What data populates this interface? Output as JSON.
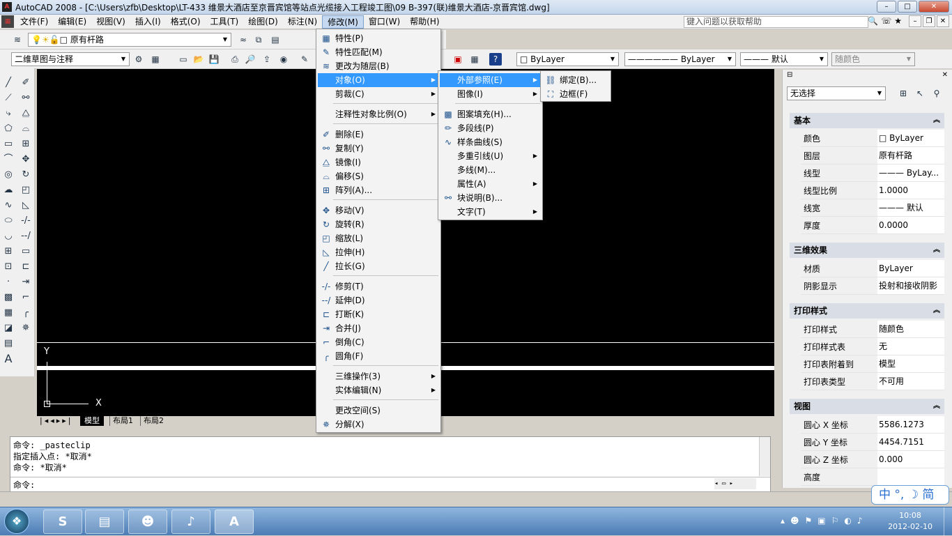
{
  "window": {
    "title": "AutoCAD 2008 - [C:\\Users\\zfb\\Desktop\\LT-433 维景大酒店至京晋宾馆等站点光缆接入工程竣工图\\09 B-397(联)维景大酒店-京晋宾馆.dwg]",
    "min": "–",
    "max": "□",
    "close": "✕",
    "app_icon": "A"
  },
  "menubar": {
    "items": [
      "文件(F)",
      "编辑(E)",
      "视图(V)",
      "插入(I)",
      "格式(O)",
      "工具(T)",
      "绘图(D)",
      "标注(N)",
      "修改(M)",
      "窗口(W)",
      "帮助(H)"
    ],
    "help_placeholder": "键入问题以获取帮助"
  },
  "toolbar": {
    "layer": "原有杆路",
    "workspace": "二维草图与注释",
    "color": "ByLayer",
    "linetype": "ByLayer",
    "lineweight": "默认",
    "plotstyle": "随颜色"
  },
  "modify_menu": {
    "items": [
      {
        "label": "特性(P)",
        "icon": "properties-icon"
      },
      {
        "label": "特性匹配(M)",
        "icon": "match-icon"
      },
      {
        "label": "更改为随层(B)",
        "icon": "bylayer-icon"
      },
      {
        "label": "对象(O)",
        "sub": true
      },
      {
        "label": "剪裁(C)",
        "sub": true
      },
      {
        "label": "注释性对象比例(O)",
        "sub": true
      },
      {
        "label": "删除(E)",
        "icon": "erase-icon"
      },
      {
        "label": "复制(Y)",
        "icon": "copy-icon"
      },
      {
        "label": "镜像(I)",
        "icon": "mirror-icon"
      },
      {
        "label": "偏移(S)",
        "icon": "offset-icon"
      },
      {
        "label": "阵列(A)...",
        "icon": "array-icon"
      },
      {
        "label": "移动(V)",
        "icon": "move-icon"
      },
      {
        "label": "旋转(R)",
        "icon": "rotate-icon"
      },
      {
        "label": "缩放(L)",
        "icon": "scale-icon"
      },
      {
        "label": "拉伸(H)",
        "icon": "stretch-icon"
      },
      {
        "label": "拉长(G)",
        "icon": "lengthen-icon"
      },
      {
        "label": "修剪(T)",
        "icon": "trim-icon"
      },
      {
        "label": "延伸(D)",
        "icon": "extend-icon"
      },
      {
        "label": "打断(K)",
        "icon": "break-icon"
      },
      {
        "label": "合并(J)",
        "icon": "join-icon"
      },
      {
        "label": "倒角(C)",
        "icon": "chamfer-icon"
      },
      {
        "label": "圆角(F)",
        "icon": "fillet-icon"
      },
      {
        "label": "三维操作(3)",
        "sub": true
      },
      {
        "label": "实体编辑(N)",
        "sub": true
      },
      {
        "label": "更改空间(S)"
      },
      {
        "label": "分解(X)",
        "icon": "explode-icon"
      }
    ]
  },
  "object_menu": {
    "items": [
      {
        "label": "外部参照(E)",
        "sub": true
      },
      {
        "label": "图像(I)",
        "sub": true
      },
      {
        "label": "图案填充(H)...",
        "icon": "hatch-icon"
      },
      {
        "label": "多段线(P)",
        "icon": "polyline-icon"
      },
      {
        "label": "样条曲线(S)",
        "icon": "spline-icon"
      },
      {
        "label": "多重引线(U)",
        "sub": true
      },
      {
        "label": "多线(M)..."
      },
      {
        "label": "属性(A)",
        "sub": true
      },
      {
        "label": "块说明(B)...",
        "icon": "block-icon"
      },
      {
        "label": "文字(T)",
        "sub": true
      }
    ]
  },
  "xref_menu": {
    "items": [
      {
        "label": "绑定(B)...",
        "icon": "bind-icon"
      },
      {
        "label": "边框(F)",
        "icon": "frame-icon"
      }
    ]
  },
  "drawing": {
    "axis_y": "Y",
    "axis_x": "X"
  },
  "layout_tabs": [
    "模型",
    "布局1",
    "布局2"
  ],
  "command": {
    "lines": [
      "命令: _pasteclip",
      "指定插入点: *取消*",
      "命令: *取消*"
    ],
    "prompt": "命令:"
  },
  "properties": {
    "selection": "无选择",
    "sections": [
      {
        "title": "基本",
        "rows": [
          [
            "颜色",
            "□ ByLayer"
          ],
          [
            "图层",
            "原有杆路"
          ],
          [
            "线型",
            "——— ByLay..."
          ],
          [
            "线型比例",
            "1.0000"
          ],
          [
            "线宽",
            "——— 默认"
          ],
          [
            "厚度",
            "0.0000"
          ]
        ]
      },
      {
        "title": "三维效果",
        "rows": [
          [
            "材质",
            "ByLayer"
          ],
          [
            "阴影显示",
            "投射和接收阴影"
          ]
        ]
      },
      {
        "title": "打印样式",
        "rows": [
          [
            "打印样式",
            "随颜色"
          ],
          [
            "打印样式表",
            "无"
          ],
          [
            "打印表附着到",
            "模型"
          ],
          [
            "打印表类型",
            "不可用"
          ]
        ]
      },
      {
        "title": "视图",
        "rows": [
          [
            "圆心 X 坐标",
            "5586.1273"
          ],
          [
            "圆心 Y 坐标",
            "4454.7151"
          ],
          [
            "圆心 Z 坐标",
            "0.000"
          ],
          [
            "高度",
            ""
          ]
        ]
      }
    ]
  },
  "ime": "中 °, ☽ 简",
  "taskbar": {
    "time": "10:08",
    "date": "2012-02-10"
  }
}
